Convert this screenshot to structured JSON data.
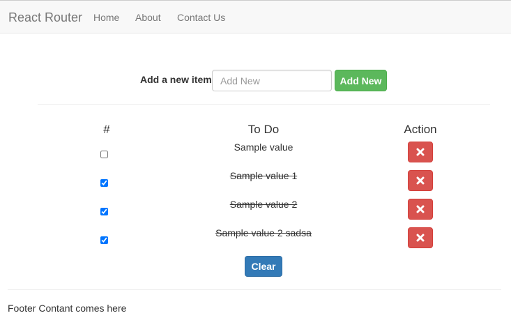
{
  "navbar": {
    "brand": "React Router",
    "links": [
      {
        "label": "Home"
      },
      {
        "label": "About"
      },
      {
        "label": "Contact Us"
      }
    ]
  },
  "add_form": {
    "label": "Add a new item:",
    "input_placeholder": "Add New",
    "input_value": "",
    "button_label": "Add New"
  },
  "table": {
    "headers": {
      "index": "#",
      "todo": "To Do",
      "action": "Action"
    },
    "rows": [
      {
        "text": "Sample value",
        "checked": false,
        "delete_icon": "times-icon"
      },
      {
        "text": "Sample value 1",
        "checked": true,
        "delete_icon": "times-icon"
      },
      {
        "text": "Sample value 2",
        "checked": true,
        "delete_icon": "times-icon"
      },
      {
        "text": "Sample value 2 sadsa",
        "checked": true,
        "delete_icon": "times-icon"
      }
    ]
  },
  "clear_button": "Clear",
  "footer": "Footer Contant comes here",
  "colors": {
    "success": "#5cb85c",
    "danger": "#d9534f",
    "primary": "#337ab7",
    "navbar_bg": "#f8f8f8",
    "nav_text": "#777777"
  }
}
